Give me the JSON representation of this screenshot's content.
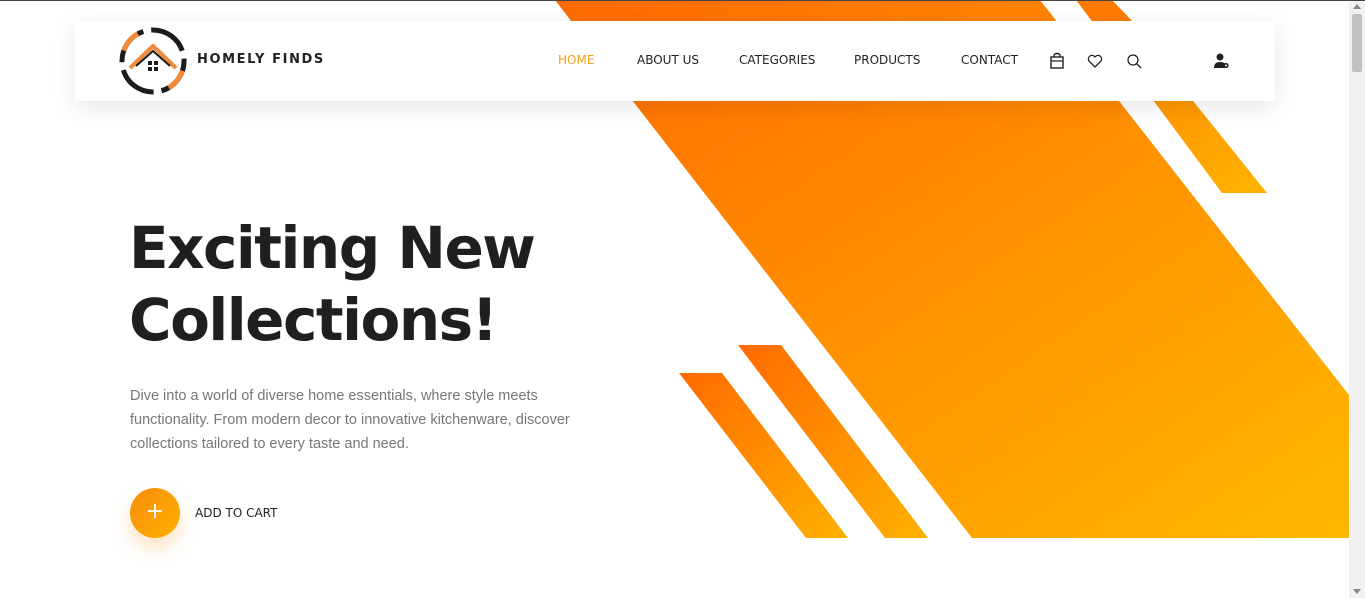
{
  "brand": {
    "name": "HOMELY FINDS"
  },
  "nav": [
    {
      "label": "HOME",
      "active": true
    },
    {
      "label": "ABOUT US",
      "active": false
    },
    {
      "label": "CATEGORIES",
      "active": false
    },
    {
      "label": "PRODUCTS",
      "active": false
    },
    {
      "label": "CONTACT",
      "active": false
    }
  ],
  "header_icons": [
    "shopping-bag-icon",
    "heart-icon",
    "search-icon",
    "user-icon"
  ],
  "hero": {
    "title_line1": "Exciting New",
    "title_line2": "Collections!",
    "description": "Dive into a world of diverse home essentials, where style meets functionality. From modern decor to innovative kitchenware, discover collections tailored to every taste and need.",
    "cta_icon": "+",
    "cta_label": "ADD TO CART"
  },
  "colors": {
    "accent": "#f7a11a",
    "orange_dark": "#ff7400",
    "orange_light": "#ffb300",
    "text_dark": "#1f1f1f",
    "text_muted": "#777777"
  }
}
